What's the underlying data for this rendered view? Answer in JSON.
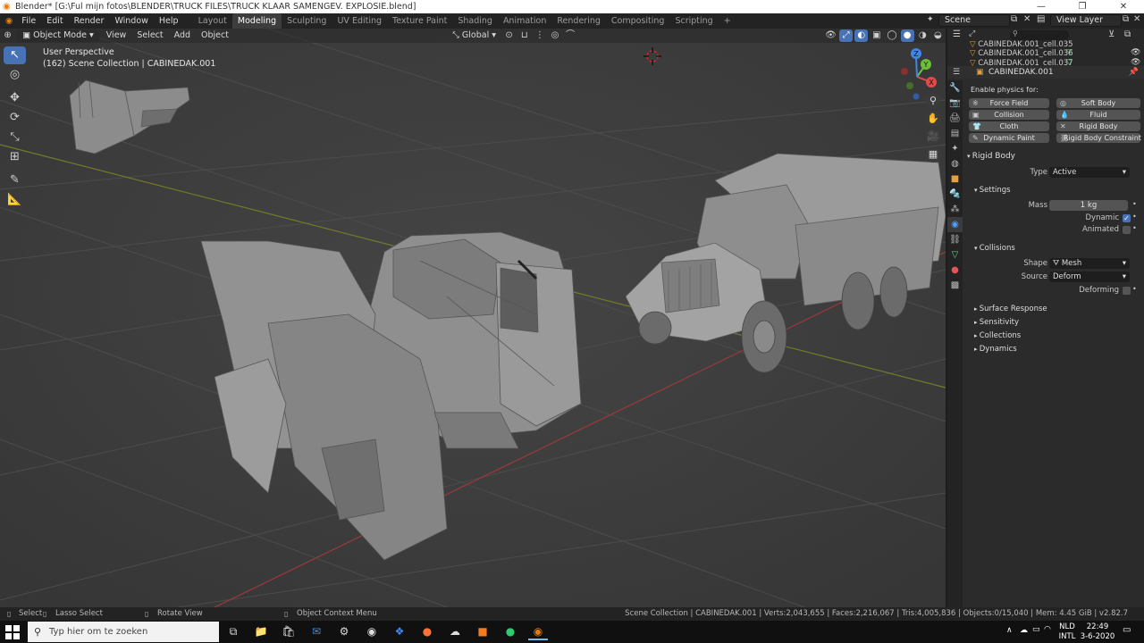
{
  "titlebar": {
    "title": "Blender* [G:\\Ful mijn fotos\\BLENDER\\TRUCK FILES\\TRUCK KLAAR SAMENGEV. EXPLOSIE.blend]",
    "minimize": "—",
    "maximize": "❐",
    "close": "✕"
  },
  "menubar": {
    "items": [
      "File",
      "Edit",
      "Render",
      "Window",
      "Help"
    ],
    "workspaces": [
      "Layout",
      "Modeling",
      "Sculpting",
      "UV Editing",
      "Texture Paint",
      "Shading",
      "Animation",
      "Rendering",
      "Compositing",
      "Scripting"
    ],
    "active_workspace": "Modeling",
    "add_workspace": "+",
    "scene": "Scene",
    "view_layer": "View Layer"
  },
  "viewport_header": {
    "mode": "Object Mode",
    "menus": [
      "View",
      "Select",
      "Add",
      "Object"
    ],
    "orientation": "Global"
  },
  "viewport": {
    "perspective_label": "User Perspective",
    "collection_label": "(162) Scene Collection | CABINEDAK.001"
  },
  "gizmo": {
    "x": "X",
    "y": "Y",
    "z": "Z",
    "colors": {
      "x": "#e04a4a",
      "y": "#6bbf3b",
      "z": "#3f86e8"
    }
  },
  "outliner": {
    "rows": [
      "CABINEDAK.001_cell.035",
      "CABINEDAK.001_cell.036",
      "CABINEDAK.001_cell.037"
    ],
    "search_placeholder": ""
  },
  "properties": {
    "object_name": "CABINEDAK.001",
    "enable_physics_label": "Enable physics for:",
    "physics_buttons": [
      [
        "Force Field",
        "Soft Body"
      ],
      [
        "Collision",
        "Fluid"
      ],
      [
        "Cloth",
        "Rigid Body"
      ],
      [
        "Dynamic Paint",
        "Rigid Body Constraint"
      ]
    ],
    "rigid_body_title": "Rigid Body",
    "type_label": "Type",
    "type_value": "Active",
    "settings_title": "Settings",
    "mass_label": "Mass",
    "mass_value": "1 kg",
    "dynamic_label": "Dynamic",
    "dynamic_checked": true,
    "animated_label": "Animated",
    "animated_checked": false,
    "collisions_title": "Collisions",
    "shape_label": "Shape",
    "shape_value": "Mesh",
    "source_label": "Source",
    "source_value": "Deform",
    "deforming_label": "Deforming",
    "deforming_checked": false,
    "subpanels": [
      "Surface Response",
      "Sensitivity",
      "Collections",
      "Dynamics"
    ]
  },
  "statusbar": {
    "select": "Select",
    "lasso": "Lasso Select",
    "rotate": "Rotate View",
    "context_menu": "Object Context Menu",
    "stats": "Scene Collection | CABINEDAK.001 | Verts:2,043,655 | Faces:2,216,067 | Tris:4,005,836 | Objects:0/15,040 | Mem: 4.45 GiB | v2.82.7"
  },
  "taskbar": {
    "search_placeholder": "Typ hier om te zoeken",
    "lang_top": "NLD",
    "lang_bottom": "INTL",
    "time": "22:49",
    "date": "3-6-2020"
  },
  "colors": {
    "accent": "#4772b3",
    "viewport_bg": "#3b3b3b",
    "panel_bg": "#2b2b2b",
    "header_bg": "#232323"
  }
}
